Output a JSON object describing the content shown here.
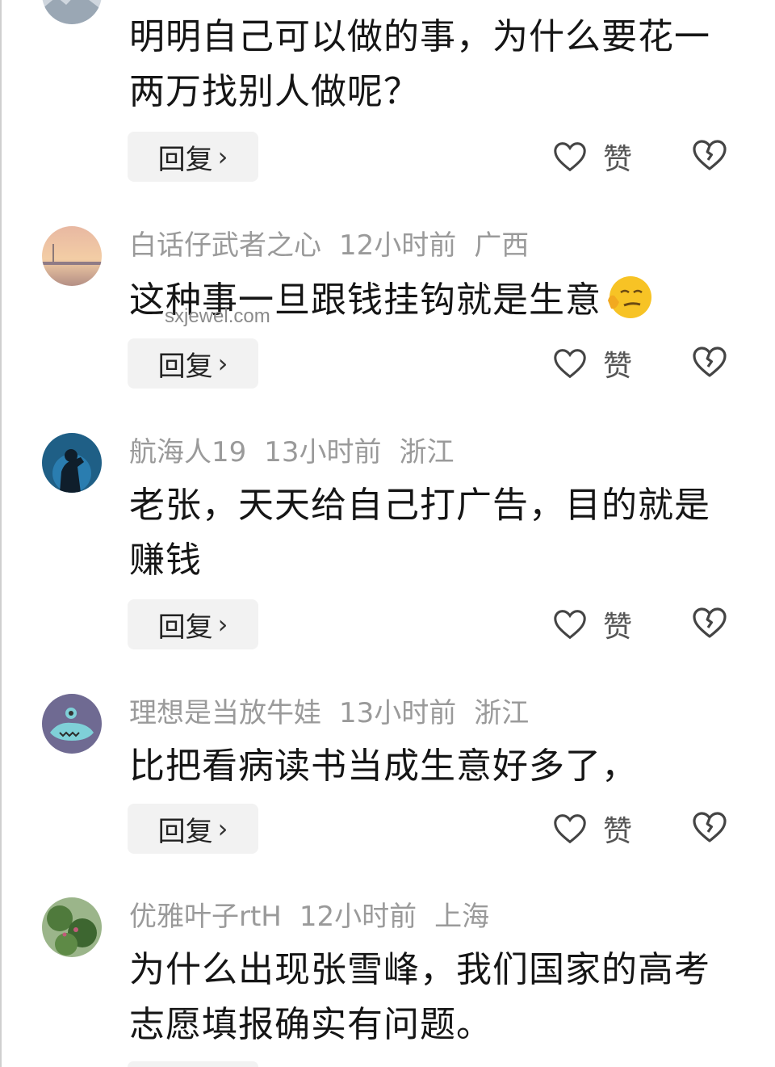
{
  "comments": [
    {
      "user": "",
      "time": "",
      "location": "",
      "text": "明明自己可以做的事，为什么要花一两万找别人做呢？",
      "reply_label": "回复",
      "like_label": "赞"
    },
    {
      "user": "白话仔武者之心",
      "time": "12小时前",
      "location": "广西",
      "text": "这种事一旦跟钱挂钩就是生意",
      "reply_label": "回复",
      "like_label": "赞"
    },
    {
      "user": "航海人19",
      "time": "13小时前",
      "location": "浙江",
      "text": "老张，天天给自己打广告，目的就是赚钱",
      "reply_label": "回复",
      "like_label": "赞"
    },
    {
      "user": "理想是当放牛娃",
      "time": "13小时前",
      "location": "浙江",
      "text": "比把看病读书当成生意好多了，",
      "reply_label": "回复",
      "like_label": "赞"
    },
    {
      "user": "优雅叶子rtH",
      "time": "12小时前",
      "location": "上海",
      "text": "为什么出现张雪峰，我们国家的高考志愿填报确实有问题。"
    }
  ],
  "watermark": "sxjewel.com",
  "icons": {
    "like": "heart-outline-icon",
    "dislike": "broken-heart-icon",
    "reply_chevron": "chevron-right-icon"
  }
}
